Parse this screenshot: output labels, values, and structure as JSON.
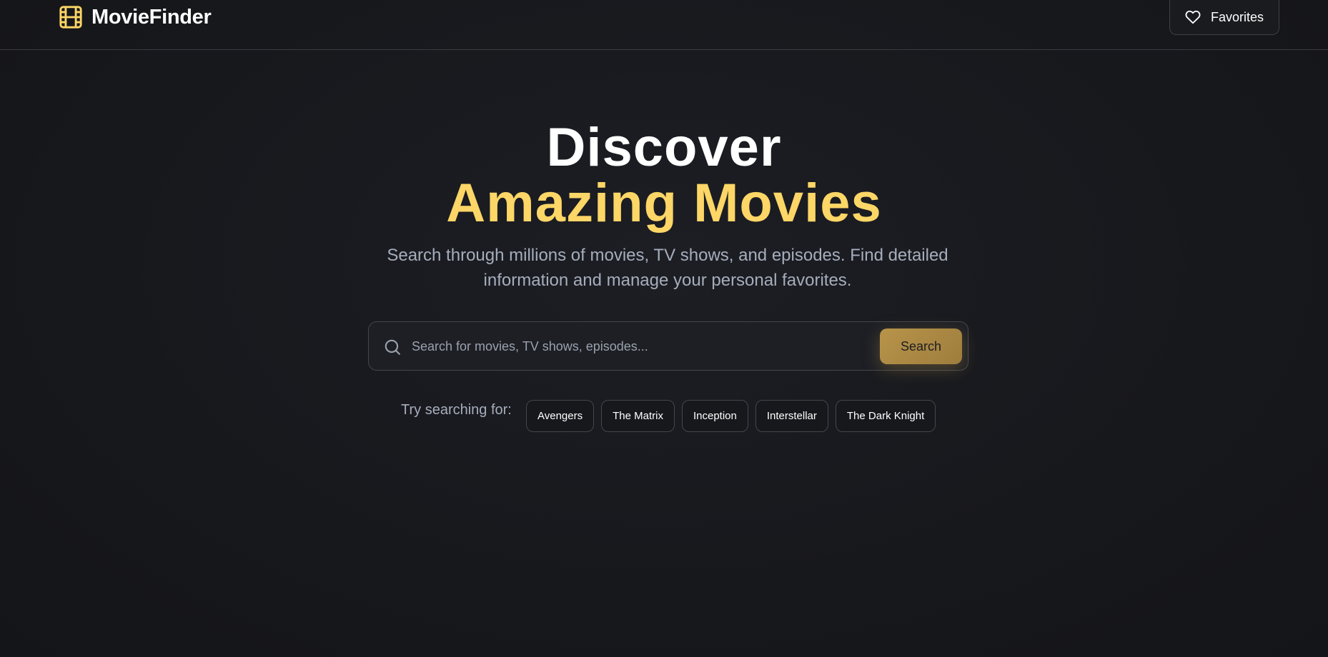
{
  "header": {
    "brand_name": "MovieFinder",
    "brand_icon": "film-icon",
    "favorites_label": "Favorites",
    "favorites_icon": "heart-icon"
  },
  "hero": {
    "title_line1": "Discover",
    "title_line2": "Amazing Movies",
    "subtitle": "Search through millions of movies, TV shows, and episodes. Find detailed information and manage your personal favorites."
  },
  "search": {
    "placeholder": "Search for movies, TV shows, episodes...",
    "value": "",
    "button_label": "Search",
    "icon": "search-icon"
  },
  "suggestions": {
    "label": "Try searching for:",
    "items": [
      "Avengers",
      "The Matrix",
      "Inception",
      "Interstellar",
      "The Dark Knight"
    ]
  },
  "colors": {
    "accent": "#fcd666",
    "button": "#b8944a",
    "background": "#17181c",
    "muted_text": "#a6adbb"
  }
}
